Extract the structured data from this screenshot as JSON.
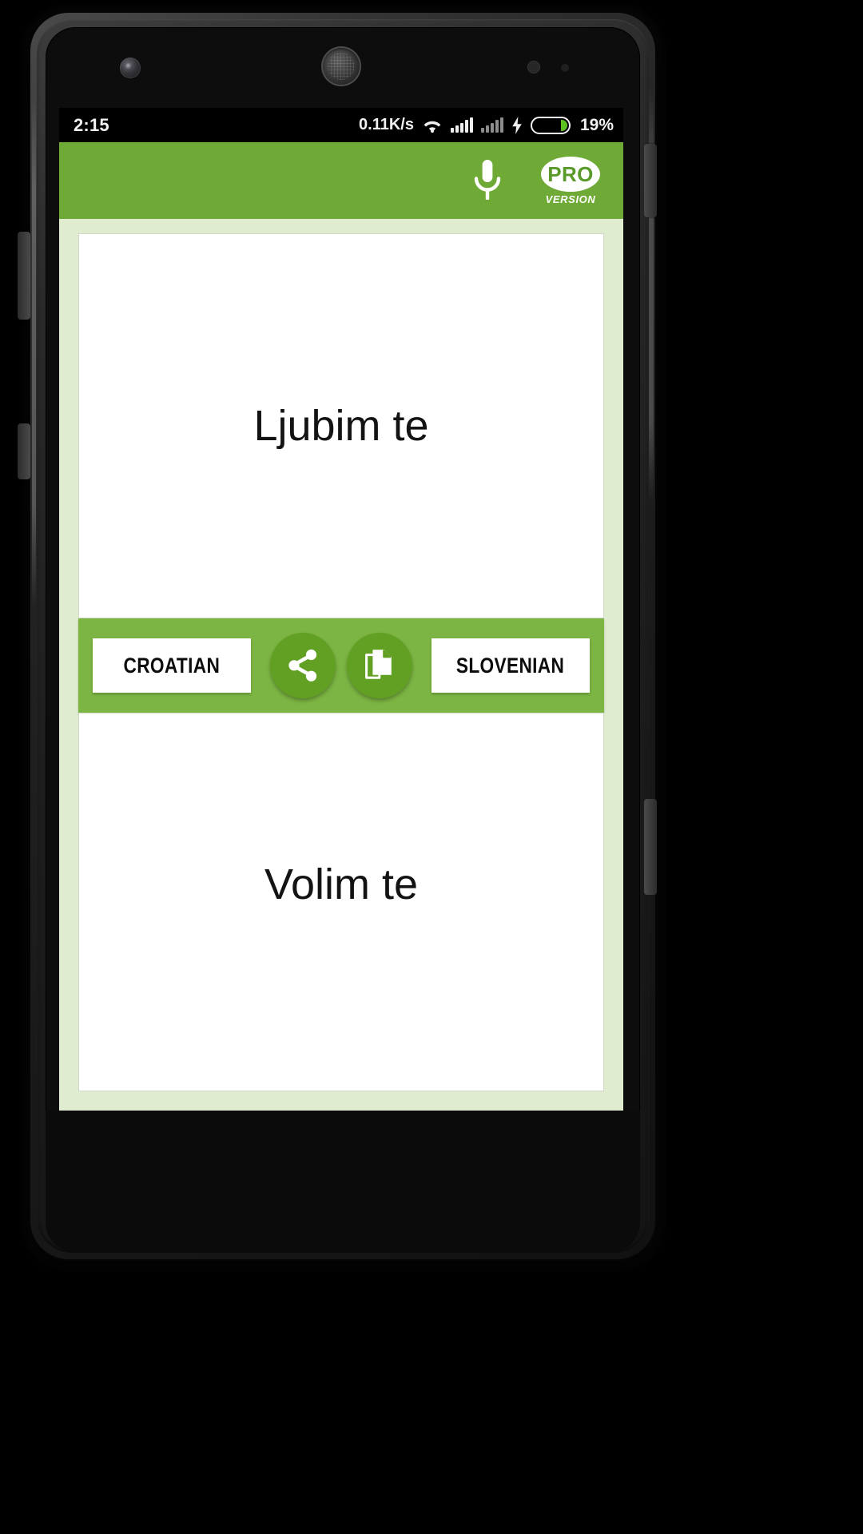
{
  "device": {
    "name": "android-phone-mockup"
  },
  "status_bar": {
    "time": "2:15",
    "network_rate": "0.11K/s",
    "wifi_icon": "wifi-icon",
    "signal_icon_1": "signal-bars-icon",
    "signal_icon_2": "signal-bars-icon",
    "charging_icon": "charging-bolt-icon",
    "battery_icon": "battery-icon",
    "battery_percent": "19%",
    "battery_level": 19
  },
  "app_bar": {
    "mic_icon": "microphone-icon",
    "mic_label": "Voice input",
    "pro_badge_text": "PRO",
    "pro_badge_sub": "VERSION",
    "accent_color": "#6faa36"
  },
  "source_panel": {
    "text": "Ljubim te"
  },
  "target_panel": {
    "text": "Volim te"
  },
  "control_bar": {
    "source_language": "CROATIAN",
    "target_language": "SLOVENIAN",
    "share_icon": "share-icon",
    "copy_icon": "copy-icon",
    "bar_color": "#7cb543",
    "button_color": "#62a024"
  },
  "colors": {
    "app_background": "#dfecd0",
    "panel_background": "#ffffff",
    "text_primary": "#131313",
    "status_bar_background": "#000000",
    "battery_fill": "#5cc220"
  }
}
